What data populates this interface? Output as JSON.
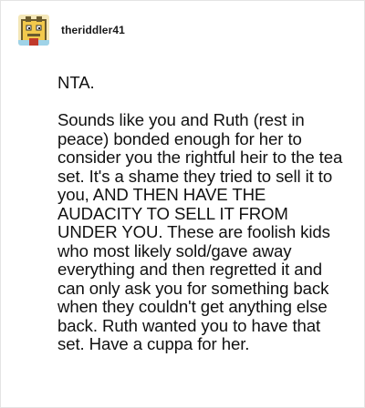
{
  "post": {
    "username": "theriddler41",
    "avatar_icon": "pixel-art-avatar",
    "verdict": "NTA.",
    "body": "Sounds like you and Ruth (rest in peace) bonded enough for her to consider you the rightful heir to the tea set. It's a shame they tried to sell it to you, AND THEN HAVE THE AUDACITY TO SELL IT FROM UNDER YOU. These are foolish kids who most likely sold/gave away everything and then regretted it and can only ask you for something back when they couldn't get anything else back. Ruth wanted you to have that set. Have a cuppa for her."
  },
  "colors": {
    "border": "#e4e4e4",
    "avatar_frame": "#f2c94c",
    "avatar_accent": "#6b5b2e"
  }
}
